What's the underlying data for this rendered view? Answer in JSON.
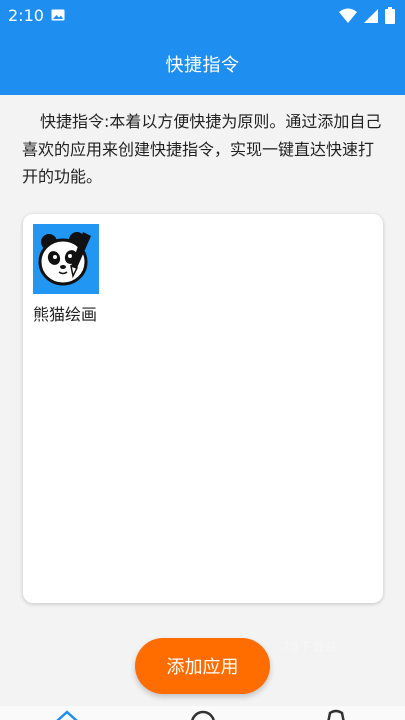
{
  "status_bar": {
    "time": "2:10",
    "icons": [
      "image-icon",
      "wifi-icon",
      "signal-icon",
      "battery-icon"
    ]
  },
  "app_bar": {
    "title": "快捷指令"
  },
  "description": "快捷指令:本着以方便快捷为原则。通过添加自己喜欢的应用来创建快捷指令，实现一键直达快速打开的功能。",
  "shortcuts": [
    {
      "label": "熊猫绘画",
      "icon": "panda-painting-app-icon"
    }
  ],
  "add_button": {
    "label": "添加应用"
  },
  "watermark": "78下载站",
  "bottom_nav": {
    "icons": [
      "home-icon",
      "search-icon",
      "profile-icon"
    ]
  },
  "colors": {
    "primary": "#1f8ef1",
    "accent": "#ff6d00",
    "background": "#f3f3f3"
  }
}
